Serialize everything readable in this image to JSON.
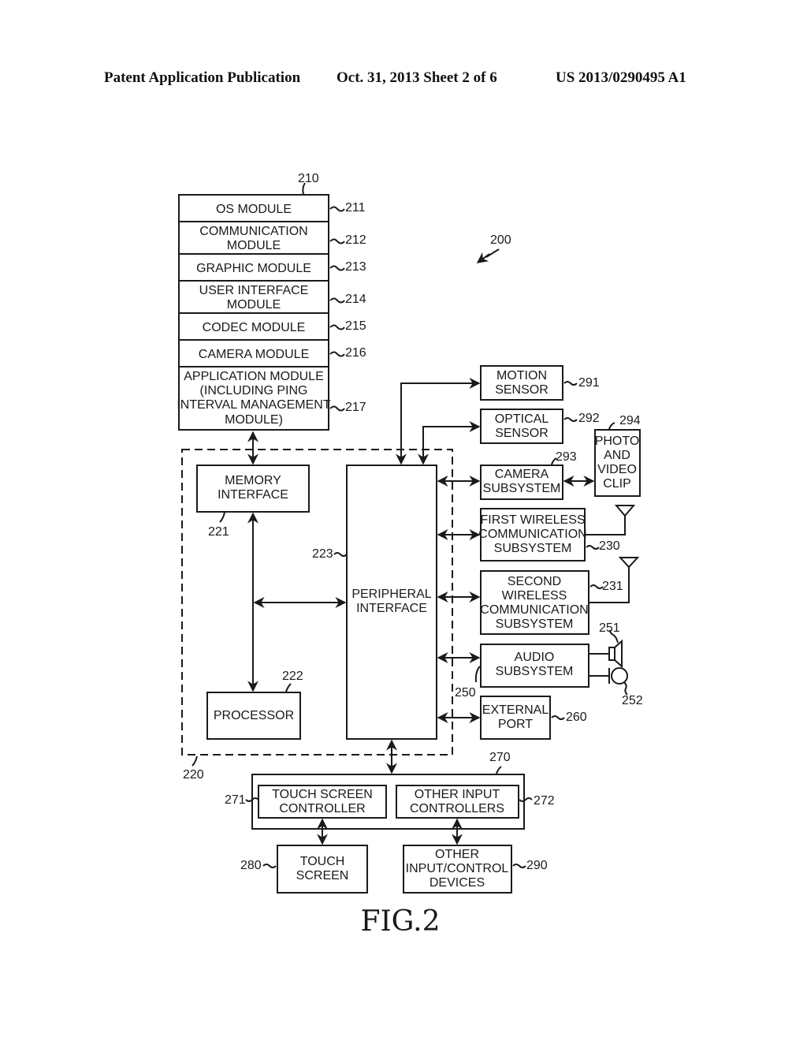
{
  "header": {
    "publication": "Patent Application Publication",
    "date_sheet": "Oct. 31, 2013   Sheet 2 of 6",
    "number": "US 2013/0290495 A1"
  },
  "figure": {
    "caption": "FIG.2",
    "system_ref": "200",
    "memory_stack": {
      "ref": "210",
      "modules": [
        {
          "ref": "211",
          "lines": [
            "OS MODULE"
          ]
        },
        {
          "ref": "212",
          "lines": [
            "COMMUNICATION",
            "MODULE"
          ]
        },
        {
          "ref": "213",
          "lines": [
            "GRAPHIC MODULE"
          ]
        },
        {
          "ref": "214",
          "lines": [
            "USER INTERFACE",
            "MODULE"
          ]
        },
        {
          "ref": "215",
          "lines": [
            "CODEC MODULE"
          ]
        },
        {
          "ref": "216",
          "lines": [
            "CAMERA MODULE"
          ]
        },
        {
          "ref": "217",
          "lines": [
            "APPLICATION MODULE",
            "(INCLUDING PING",
            "INTERVAL MANAGEMENT",
            "MODULE)"
          ]
        }
      ]
    },
    "core": {
      "ref": "220",
      "memory_interface": {
        "ref": "221",
        "lines": [
          "MEMORY",
          "INTERFACE"
        ]
      },
      "processor": {
        "ref": "222",
        "lines": [
          "PROCESSOR"
        ]
      },
      "peripheral_interface": {
        "ref": "223",
        "lines": [
          "PERIPHERAL",
          "INTERFACE"
        ]
      }
    },
    "peripherals": {
      "motion_sensor": {
        "ref": "291",
        "lines": [
          "MOTION",
          "SENSOR"
        ]
      },
      "optical_sensor": {
        "ref": "292",
        "lines": [
          "OPTICAL",
          "SENSOR"
        ]
      },
      "camera_subsystem": {
        "ref": "293",
        "lines": [
          "CAMERA",
          "SUBSYSTEM"
        ]
      },
      "photo_video_clip": {
        "ref": "294",
        "lines": [
          "PHOTO",
          "AND",
          "VIDEO",
          "CLIP"
        ]
      },
      "first_wireless": {
        "ref": "230",
        "lines": [
          "FIRST WIRELESS",
          "COMMUNICATION",
          "SUBSYSTEM"
        ]
      },
      "second_wireless": {
        "ref": "231",
        "lines": [
          "SECOND",
          "WIRELESS",
          "COMMUNICATION",
          "SUBSYSTEM"
        ]
      },
      "audio_subsystem": {
        "ref": "250",
        "lines": [
          "AUDIO",
          "SUBSYSTEM"
        ]
      },
      "speaker": {
        "ref": "251"
      },
      "microphone": {
        "ref": "252"
      },
      "external_port": {
        "ref": "260",
        "lines": [
          "EXTERNAL",
          "PORT"
        ]
      }
    },
    "io_subsystem": {
      "ref": "270",
      "touch_screen_controller": {
        "ref": "271",
        "lines": [
          "TOUCH SCREEN",
          "CONTROLLER"
        ]
      },
      "other_input_controllers": {
        "ref": "272",
        "lines": [
          "OTHER INPUT",
          "CONTROLLERS"
        ]
      },
      "touch_screen": {
        "ref": "280",
        "lines": [
          "TOUCH",
          "SCREEN"
        ]
      },
      "other_input_devices": {
        "ref": "290",
        "lines": [
          "OTHER",
          "INPUT/CONTROL",
          "DEVICES"
        ]
      }
    }
  }
}
